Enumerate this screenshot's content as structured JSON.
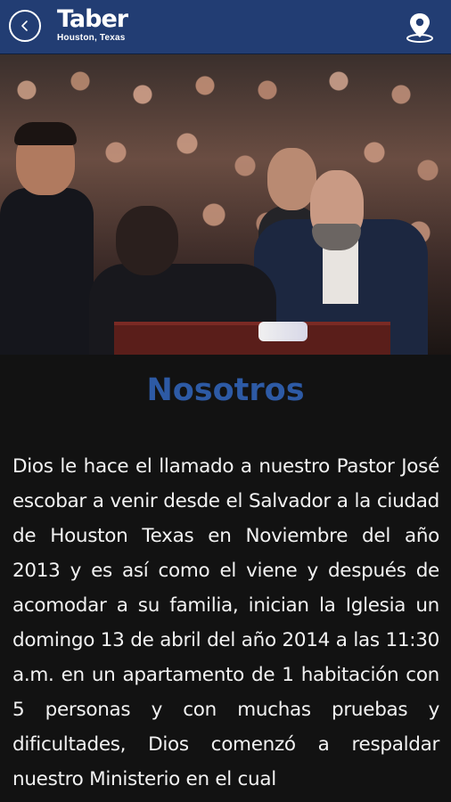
{
  "header": {
    "brand_name": "Taber",
    "brand_location": "Houston, Texas",
    "back_icon": "chevron-left-icon",
    "location_icon": "map-pin-icon"
  },
  "hero": {
    "image": "church-ceremony-photo"
  },
  "section": {
    "title": "Nosotros",
    "body": "Dios le hace el llamado a nuestro Pastor José escobar a venir desde el Salvador a la ciudad de Houston Texas en Noviembre del año 2013 y es así como el viene y después de acomodar a su familia, inician la Iglesia un domingo 13 de abril del año 2014 a las 11:30 a.m. en un apartamento de 1 habitación con 5 personas y con muchas pruebas y dificultades, Dios comenzó a respaldar nuestro Ministerio en el cual"
  },
  "colors": {
    "header_bg": "#223d73",
    "title": "#2d5aa5",
    "page_bg": "#121212",
    "text": "#f2f2f2"
  }
}
